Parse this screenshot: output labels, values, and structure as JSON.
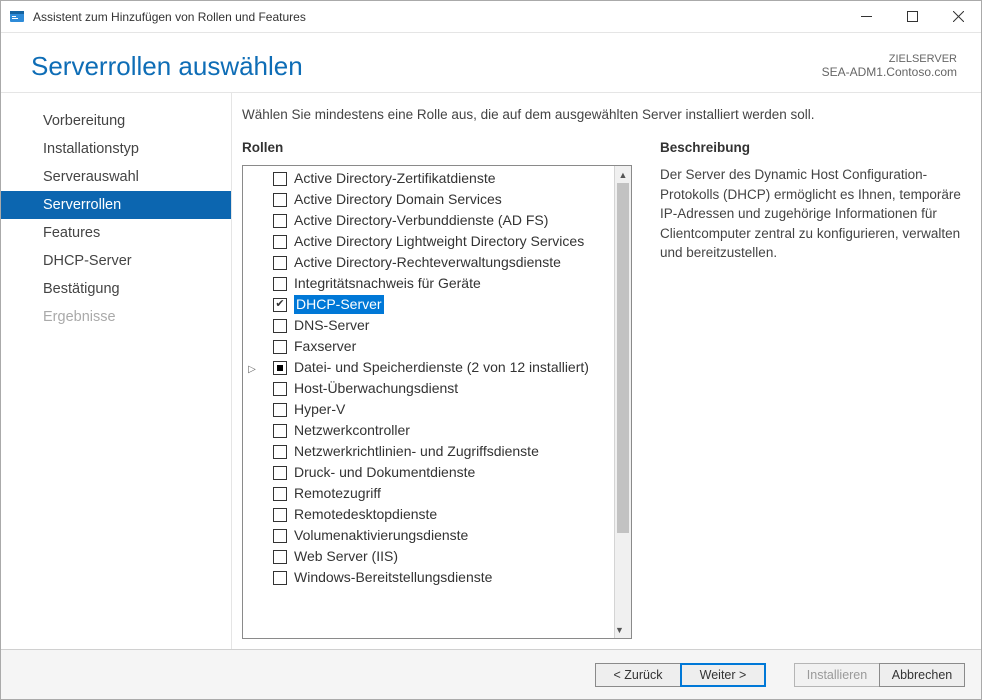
{
  "window": {
    "title": "Assistent zum Hinzufügen von Rollen und Features"
  },
  "header": {
    "page_title": "Serverrollen auswählen",
    "target_label": "ZIELSERVER",
    "target_server": "SEA-ADM1.Contoso.com"
  },
  "nav": {
    "items": [
      {
        "label": "Vorbereitung",
        "state": "normal"
      },
      {
        "label": "Installationstyp",
        "state": "normal"
      },
      {
        "label": "Serverauswahl",
        "state": "normal"
      },
      {
        "label": "Serverrollen",
        "state": "active"
      },
      {
        "label": "Features",
        "state": "normal"
      },
      {
        "label": "DHCP-Server",
        "state": "normal"
      },
      {
        "label": "Bestätigung",
        "state": "normal"
      },
      {
        "label": "Ergebnisse",
        "state": "disabled"
      }
    ]
  },
  "main": {
    "instruction": "Wählen Sie mindestens eine Rolle aus, die auf dem ausgewählten Server installiert werden soll.",
    "roles_label": "Rollen",
    "roles": [
      {
        "label": "Active Directory-Zertifikatdienste",
        "checked": false,
        "indeterminate": false,
        "selected": false,
        "expandable": false
      },
      {
        "label": "Active Directory Domain Services",
        "checked": false,
        "indeterminate": false,
        "selected": false,
        "expandable": false
      },
      {
        "label": "Active Directory-Verbunddienste (AD FS)",
        "checked": false,
        "indeterminate": false,
        "selected": false,
        "expandable": false
      },
      {
        "label": "Active Directory Lightweight Directory Services",
        "checked": false,
        "indeterminate": false,
        "selected": false,
        "expandable": false
      },
      {
        "label": "Active Directory-Rechteverwaltungsdienste",
        "checked": false,
        "indeterminate": false,
        "selected": false,
        "expandable": false
      },
      {
        "label": "Integritätsnachweis für Geräte",
        "checked": false,
        "indeterminate": false,
        "selected": false,
        "expandable": false
      },
      {
        "label": "DHCP-Server",
        "checked": true,
        "indeterminate": false,
        "selected": true,
        "expandable": false
      },
      {
        "label": "DNS-Server",
        "checked": false,
        "indeterminate": false,
        "selected": false,
        "expandable": false
      },
      {
        "label": "Faxserver",
        "checked": false,
        "indeterminate": false,
        "selected": false,
        "expandable": false
      },
      {
        "label": "Datei- und Speicherdienste (2 von 12 installiert)",
        "checked": false,
        "indeterminate": true,
        "selected": false,
        "expandable": true
      },
      {
        "label": "Host-Überwachungsdienst",
        "checked": false,
        "indeterminate": false,
        "selected": false,
        "expandable": false
      },
      {
        "label": "Hyper-V",
        "checked": false,
        "indeterminate": false,
        "selected": false,
        "expandable": false
      },
      {
        "label": "Netzwerkcontroller",
        "checked": false,
        "indeterminate": false,
        "selected": false,
        "expandable": false
      },
      {
        "label": "Netzwerkrichtlinien- und Zugriffsdienste",
        "checked": false,
        "indeterminate": false,
        "selected": false,
        "expandable": false
      },
      {
        "label": "Druck- und Dokumentdienste",
        "checked": false,
        "indeterminate": false,
        "selected": false,
        "expandable": false
      },
      {
        "label": "Remotezugriff",
        "checked": false,
        "indeterminate": false,
        "selected": false,
        "expandable": false
      },
      {
        "label": "Remotedesktopdienste",
        "checked": false,
        "indeterminate": false,
        "selected": false,
        "expandable": false
      },
      {
        "label": "Volumenaktivierungsdienste",
        "checked": false,
        "indeterminate": false,
        "selected": false,
        "expandable": false
      },
      {
        "label": "Web Server (IIS)",
        "checked": false,
        "indeterminate": false,
        "selected": false,
        "expandable": false
      },
      {
        "label": "Windows-Bereitstellungsdienste",
        "checked": false,
        "indeterminate": false,
        "selected": false,
        "expandable": false
      }
    ],
    "description_label": "Beschreibung",
    "description": "Der Server des Dynamic Host Configuration-Protokolls (DHCP) ermöglicht es Ihnen, temporäre IP-Adressen und zugehörige Informationen für Clientcomputer zentral zu konfigurieren, verwalten und bereitzustellen."
  },
  "footer": {
    "back": "< Zurück",
    "next": "Weiter >",
    "install": "Installieren",
    "cancel": "Abbrechen"
  }
}
